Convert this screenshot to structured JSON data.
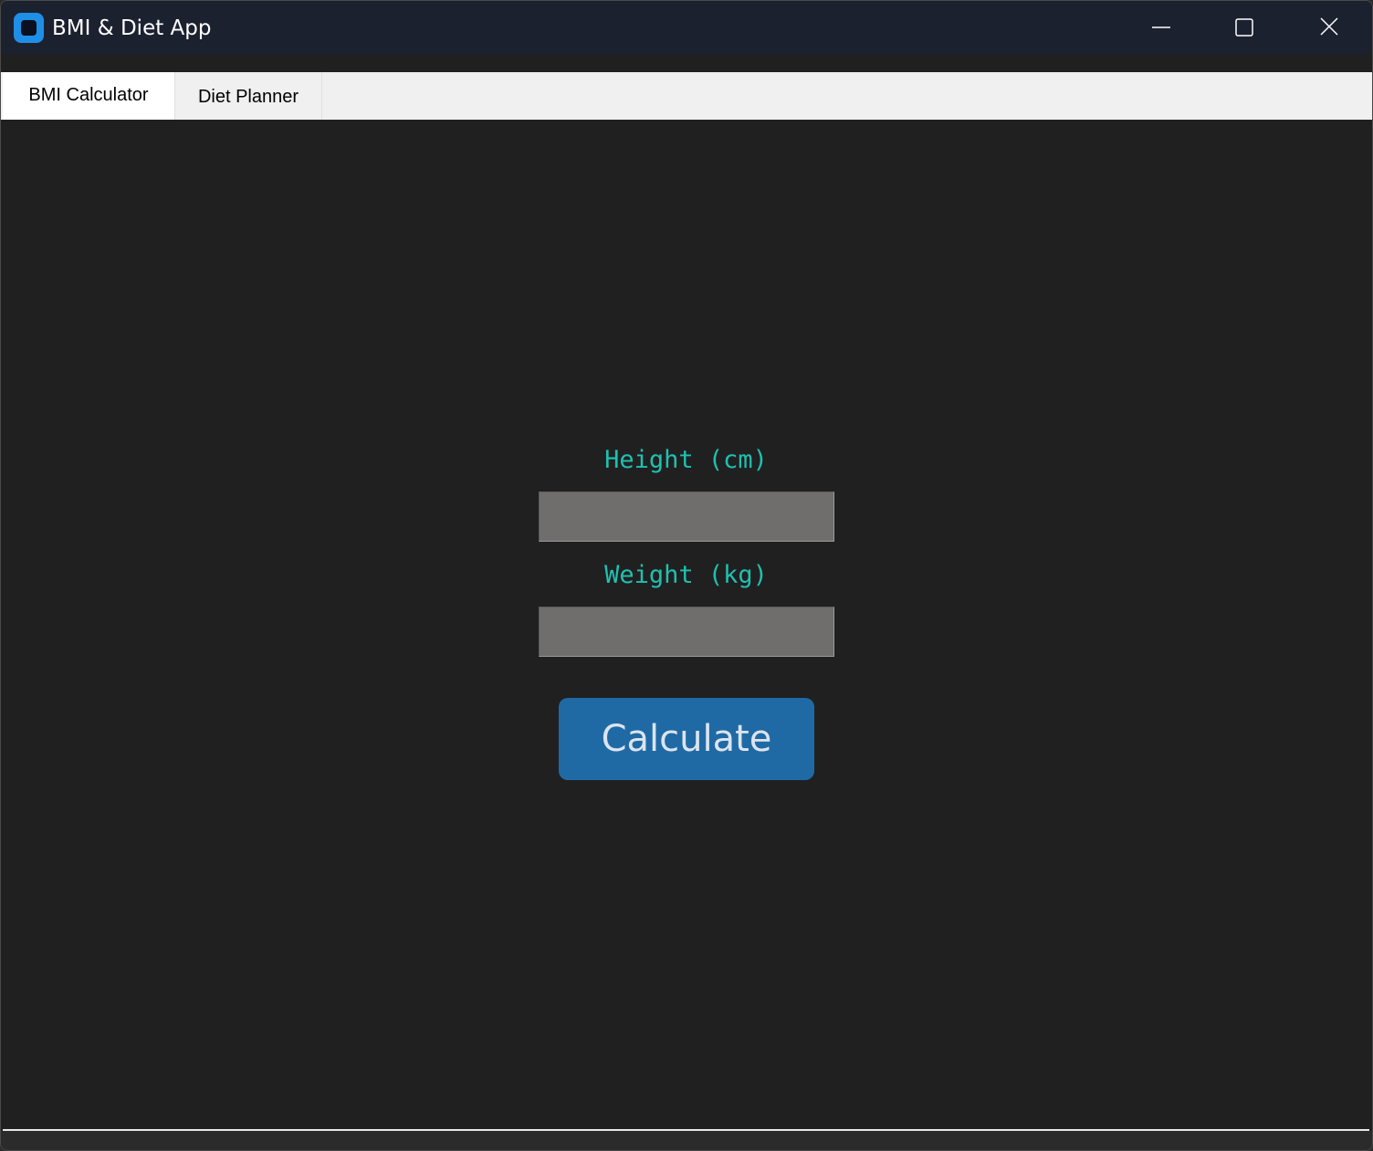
{
  "window": {
    "title": "BMI & Diet App",
    "icon": "app-icon"
  },
  "titlebar_controls": {
    "minimize_icon": "minimize-icon",
    "maximize_icon": "maximize-icon",
    "close_icon": "close-icon"
  },
  "tabs": [
    {
      "label": "BMI Calculator",
      "selected": true
    },
    {
      "label": "Diet Planner",
      "selected": false
    }
  ],
  "form": {
    "height_label": "Height (cm)",
    "height_value": "",
    "weight_label": "Weight (kg)",
    "weight_value": "",
    "calculate_label": "Calculate"
  },
  "colors": {
    "label_accent": "#20c0b0",
    "button_bg": "#1f6aa5",
    "content_bg": "#202020",
    "input_bg": "#6f6e6c"
  }
}
